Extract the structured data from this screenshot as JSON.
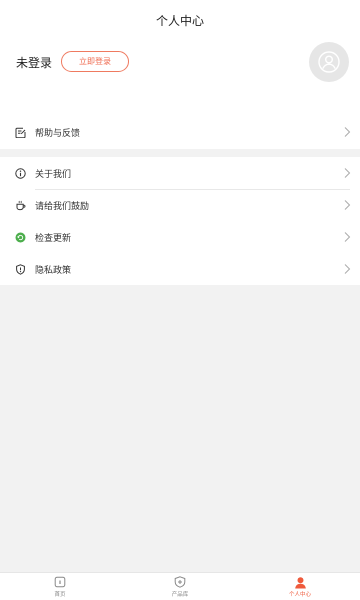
{
  "header": {
    "title": "个人中心"
  },
  "profile": {
    "username": "未登录",
    "login_button": "立即登录"
  },
  "menu_primary": [
    {
      "label": "帮助与反馈",
      "icon": "edit-note-icon"
    }
  ],
  "menu_secondary": [
    {
      "label": "关于我们",
      "icon": "info-icon"
    },
    {
      "label": "请给我们鼓励",
      "icon": "coffee-cup-icon"
    },
    {
      "label": "检查更新",
      "icon": "update-icon"
    },
    {
      "label": "隐私政策",
      "icon": "shield-icon"
    }
  ],
  "tabbar": {
    "items": [
      {
        "label": "首页",
        "icon": "home-icon",
        "active": false
      },
      {
        "label": "产品库",
        "icon": "product-library-icon",
        "active": false
      },
      {
        "label": "个人中心",
        "icon": "user-icon",
        "active": true
      }
    ]
  },
  "colors": {
    "accent": "#ef5a3c",
    "update_green": "#4cae4c",
    "background": "#f2f2f2"
  }
}
